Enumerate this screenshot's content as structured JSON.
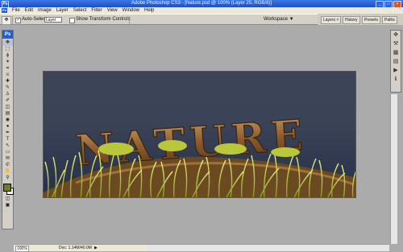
{
  "window": {
    "app_icon": "Ps",
    "title": "Adobe Photoshop CS3 - [Nature.psd @ 100% (Layer 25, RGB/8)]",
    "buttons": [
      "_",
      "□",
      "×"
    ]
  },
  "menu": {
    "logo": "Ps",
    "items": [
      "File",
      "Edit",
      "Image",
      "Layer",
      "Select",
      "Filter",
      "View",
      "Window",
      "Help"
    ]
  },
  "options": {
    "tool_icon": "move-tool-icon",
    "auto_select_label": "Auto-Select:",
    "auto_select_value": "Layer",
    "show_transform_label": "Show Transform Controls",
    "workspace_label": "Workspace ▼"
  },
  "palette_well": {
    "tabs": [
      "Layers ×",
      "History",
      "Presets",
      "Paths"
    ]
  },
  "tools_panel": {
    "logo": "Ps",
    "tools": [
      "move-tool",
      "marquee-tool",
      "lasso-tool",
      "magic-wand-tool",
      "crop-tool",
      "slice-tool",
      "healing-brush-tool",
      "brush-tool",
      "clone-stamp-tool",
      "history-brush-tool",
      "eraser-tool",
      "gradient-tool",
      "blur-tool",
      "dodge-tool",
      "pen-tool",
      "type-tool",
      "path-selection-tool",
      "shape-tool",
      "notes-tool",
      "eyedropper-tool",
      "hand-tool",
      "zoom-tool"
    ],
    "glyphs": [
      "✥",
      "⬚",
      "ϕ",
      "✶",
      "⌗",
      "⚔",
      "✚",
      "✎",
      "♙",
      "✐",
      "◫",
      "▤",
      "◉",
      "●",
      "✒",
      "T",
      "↖",
      "▭",
      "✉",
      "✆",
      "✋",
      "⚲"
    ],
    "foreground_color": "#6f7d1a",
    "background_color": "#ffffff",
    "mode_glyphs": [
      "◫",
      "▣"
    ]
  },
  "right_panel": {
    "icons": [
      "navigator-icon",
      "brush-presets-icon",
      "layer-comps-icon",
      "styles-icon",
      "actions-icon",
      "info-icon"
    ],
    "glyphs": [
      "✥",
      "⚒",
      "▦",
      "▤",
      "▶",
      "ℹ"
    ]
  },
  "canvas": {
    "headline": "NATURE"
  },
  "status": {
    "zoom": "100%",
    "doc": "Doc: 1.14M/40.0M",
    "arrow": "▶"
  }
}
